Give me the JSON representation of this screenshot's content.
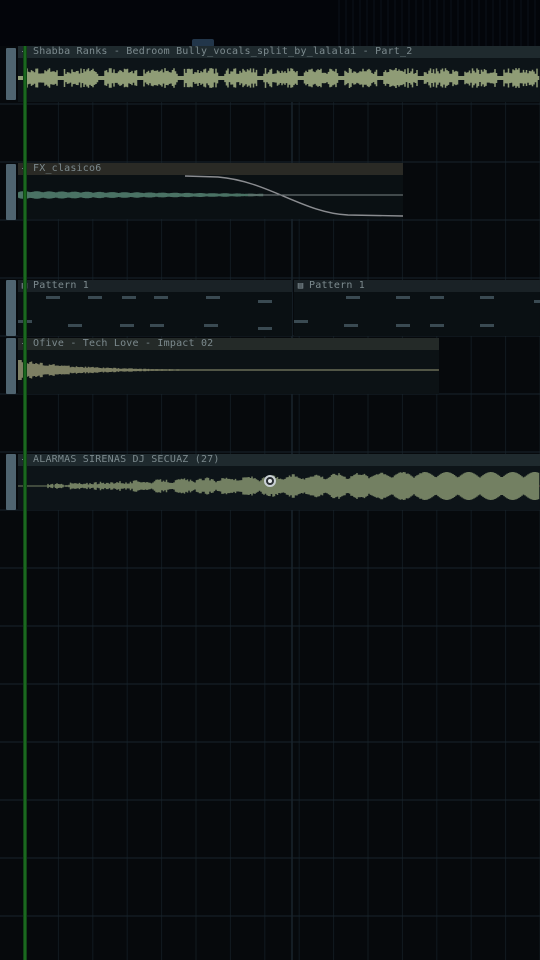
{
  "colors": {
    "background": "#06090c",
    "grid_line": "#111a20",
    "grid_bar_line": "#18242c",
    "clip_header_audio": "#1f2a2e",
    "clip_header_fx": "#2a2a25",
    "clip_body": "#0d1418",
    "waveform_vocals": "#8f9c76",
    "waveform_fx": "#4a7264",
    "waveform_impact": "#7d7f63",
    "waveform_alarm": "#738062",
    "automation_curve": "#8a8c90",
    "pattern_note": "#3a4a52",
    "playhead": "#1f7a24"
  },
  "clips": [
    {
      "title": "Shabba Ranks - Bedroom Bully_vocals_split_by_lalalai - Part_2",
      "icon": "audio-clip-icon"
    },
    {
      "title": "FX_clasico6",
      "icon": "audio-clip-icon"
    },
    {
      "title": "Pattern 1",
      "icon": "pattern-clip-icon"
    },
    {
      "title": "Pattern 1",
      "icon": "pattern-clip-icon"
    },
    {
      "title": "Ofive - Tech Love - Impact 02",
      "icon": "audio-clip-icon"
    },
    {
      "title": "ALARMAS SIRENAS DJ SECUAZ (27)",
      "icon": "audio-clip-icon"
    }
  ]
}
